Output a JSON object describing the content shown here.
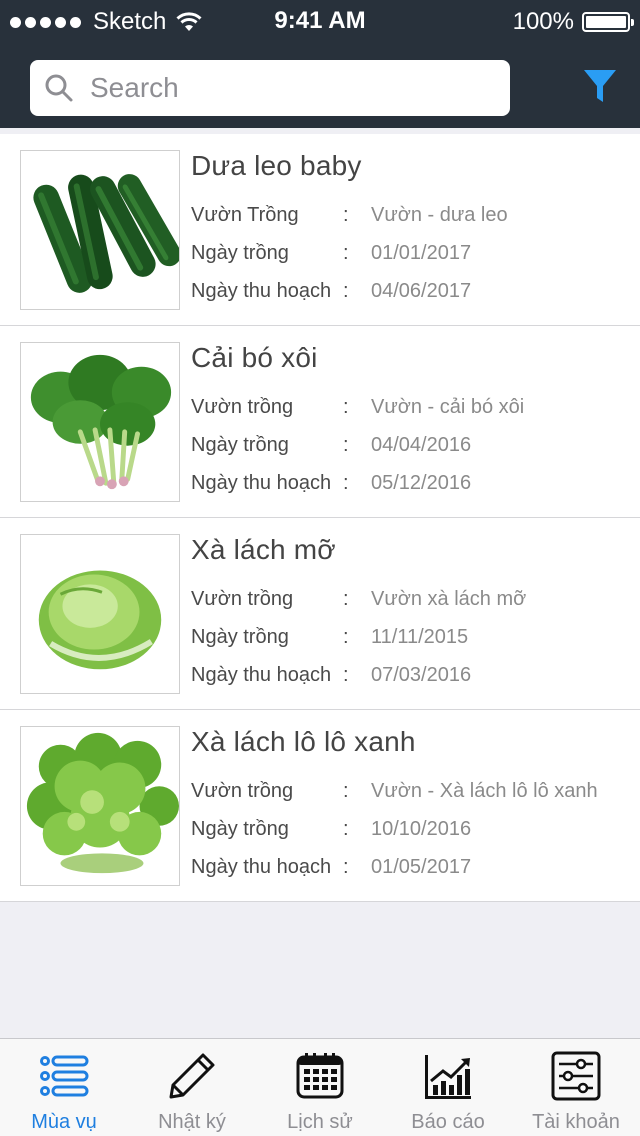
{
  "status_bar": {
    "carrier": "Sketch",
    "time": "9:41 AM",
    "battery": "100%"
  },
  "search": {
    "placeholder": "Search",
    "value": ""
  },
  "colors": {
    "header_bg": "#28313b",
    "accent": "#1f7fe0",
    "filter_icon": "#2a9df4"
  },
  "crops": [
    {
      "title": "Dưa leo baby",
      "image": "cucumber-photo",
      "garden_label": "Vườn Trồng",
      "garden_value": "Vườn - dưa leo",
      "plant_date_label": "Ngày trồng",
      "plant_date": "01/01/2017",
      "harvest_label": "Ngày thu hoạch",
      "harvest_date": "04/06/2017",
      "separator": ":"
    },
    {
      "title": "Cải bó xôi",
      "image": "spinach-photo",
      "garden_label": "Vườn trồng",
      "garden_value": "Vườn - cải bó xôi",
      "plant_date_label": "Ngày trồng",
      "plant_date": "04/04/2016",
      "harvest_label": "Ngày thu hoạch",
      "harvest_date": "05/12/2016",
      "separator": ":"
    },
    {
      "title": "Xà lách mỡ",
      "image": "butter-lettuce-photo",
      "garden_label": "Vườn trồng",
      "garden_value": "Vườn xà lách mỡ",
      "plant_date_label": "Ngày trồng",
      "plant_date": "11/11/2015",
      "harvest_label": "Ngày thu hoạch",
      "harvest_date": "07/03/2016",
      "separator": ":"
    },
    {
      "title": "Xà lách lô lô xanh",
      "image": "green-lollo-lettuce-photo",
      "garden_label": "Vườn trồng",
      "garden_value": "Vườn - Xà lách lô lô xanh",
      "plant_date_label": "Ngày trồng",
      "plant_date": "10/10/2016",
      "harvest_label": "Ngày thu hoạch",
      "harvest_date": "01/05/2017",
      "separator": ":"
    }
  ],
  "tabs": [
    {
      "label": "Mùa vụ",
      "icon": "list-icon",
      "active": true
    },
    {
      "label": "Nhật ký",
      "icon": "pencil-icon",
      "active": false
    },
    {
      "label": "Lịch sử",
      "icon": "calendar-icon",
      "active": false
    },
    {
      "label": "Báo cáo",
      "icon": "chart-icon",
      "active": false
    },
    {
      "label": "Tài khoản",
      "icon": "settings-sliders-icon",
      "active": false
    }
  ]
}
